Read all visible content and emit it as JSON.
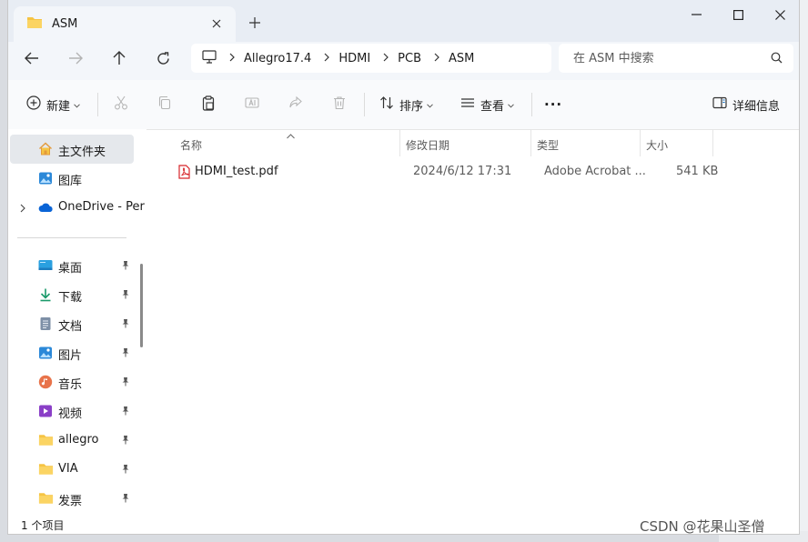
{
  "tab": {
    "title": "ASM",
    "new_tab": "+"
  },
  "window_controls": {
    "minimize": "—",
    "maximize": "☐",
    "close": "✕"
  },
  "breadcrumb": [
    "Allegro17.4",
    "HDMI",
    "PCB",
    "ASM"
  ],
  "search": {
    "placeholder": "在 ASM 中搜索"
  },
  "toolbar": {
    "new_label": "新建",
    "sort_label": "排序",
    "view_label": "查看",
    "more_label": "···",
    "details_label": "详细信息"
  },
  "sidebar": {
    "items": [
      {
        "label": "主文件夹"
      },
      {
        "label": "图库"
      },
      {
        "label": "OneDrive - Per"
      }
    ],
    "pinned": [
      {
        "label": "桌面"
      },
      {
        "label": "下载"
      },
      {
        "label": "文档"
      },
      {
        "label": "图片"
      },
      {
        "label": "音乐"
      },
      {
        "label": "视频"
      },
      {
        "label": "allegro"
      },
      {
        "label": "VIA"
      },
      {
        "label": "发票"
      }
    ]
  },
  "columns": {
    "name": "名称",
    "modified": "修改日期",
    "type": "类型",
    "size": "大小"
  },
  "files": [
    {
      "name": "HDMI_test.pdf",
      "modified": "2024/6/12 17:31",
      "type": "Adobe Acrobat ...",
      "size": "541 KB"
    }
  ],
  "status": {
    "count": "1 个项目"
  },
  "watermark": "CSDN @花果山圣僧",
  "colors": {
    "accent": "#0067c0",
    "folder": "#f6c443",
    "pdf": "#d7262b"
  }
}
